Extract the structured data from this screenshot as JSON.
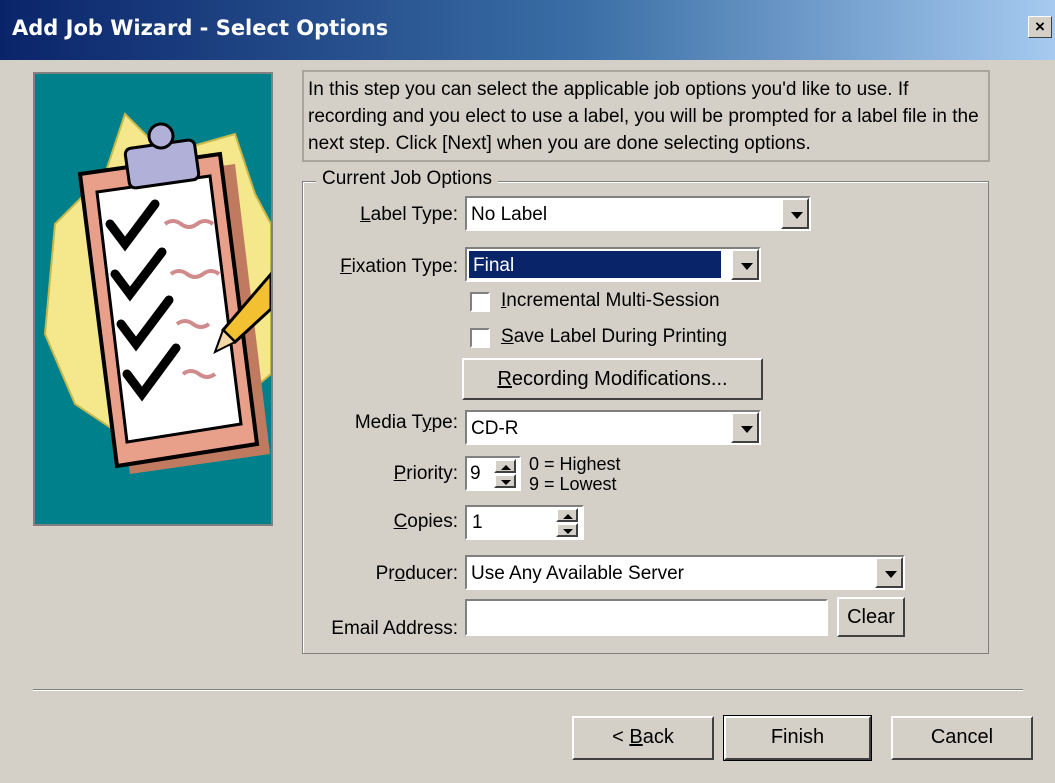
{
  "window": {
    "title": "Add Job Wizard - Select Options",
    "close_glyph": "×"
  },
  "instructions": "In this step you can select the applicable job options you'd like to use.  If recording and you elect to use a label, you will be prompted for a label file in the next step. Click [Next] when you are done selecting options.",
  "group_title": "Current Job Options",
  "label_type": {
    "label_prefix": "L",
    "label_rest": "abel Type:",
    "value": "No Label"
  },
  "fixation_type": {
    "label_prefix": "F",
    "label_rest": "ixation Type:",
    "value": "Final"
  },
  "incremental": {
    "label_prefix": "I",
    "label_rest": "ncremental Multi-Session",
    "checked": false
  },
  "save_label": {
    "label_prefix": "S",
    "label_rest": "ave Label During Printing",
    "checked": false
  },
  "recording_mod": {
    "label_prefix": "R",
    "label_rest": "ecording Modifications..."
  },
  "media_type": {
    "label_before": "Media T",
    "label_u": "y",
    "label_after": "pe:",
    "value": "CD-R"
  },
  "priority": {
    "label_prefix": "P",
    "label_rest": "riority:",
    "value": "9",
    "hint_1": "0 = Highest",
    "hint_2": "9 = Lowest"
  },
  "copies": {
    "label_prefix": "C",
    "label_rest": "opies:",
    "value": "1"
  },
  "producer": {
    "label_before": "Pr",
    "label_u": "o",
    "label_after": "ducer:",
    "value": "Use Any Available Server"
  },
  "email": {
    "label": "Email Address:",
    "value": "",
    "clear": "Clear"
  },
  "buttons": {
    "back_prefix": "< ",
    "back_u": "B",
    "back_rest": "ack",
    "finish": "Finish",
    "cancel": "Cancel"
  },
  "colors": {
    "title_start": "#0a246a",
    "title_end": "#a6caf0",
    "face": "#d4d0c8",
    "image_bg": "#00808a",
    "selection": "#0a246a"
  },
  "icons": [
    "close-icon",
    "clipboard-illustration",
    "dropdown-arrow-icon",
    "spinner-up-icon",
    "spinner-down-icon"
  ]
}
